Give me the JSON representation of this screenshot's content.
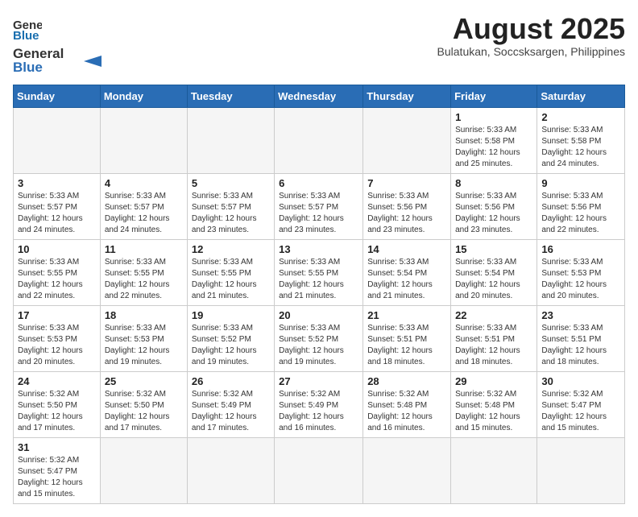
{
  "header": {
    "logo_general": "General",
    "logo_blue": "Blue",
    "month_title": "August 2025",
    "location": "Bulatukan, Soccsksargen, Philippines"
  },
  "weekdays": [
    "Sunday",
    "Monday",
    "Tuesday",
    "Wednesday",
    "Thursday",
    "Friday",
    "Saturday"
  ],
  "weeks": [
    [
      {
        "day": "",
        "info": ""
      },
      {
        "day": "",
        "info": ""
      },
      {
        "day": "",
        "info": ""
      },
      {
        "day": "",
        "info": ""
      },
      {
        "day": "",
        "info": ""
      },
      {
        "day": "1",
        "info": "Sunrise: 5:33 AM\nSunset: 5:58 PM\nDaylight: 12 hours\nand 25 minutes."
      },
      {
        "day": "2",
        "info": "Sunrise: 5:33 AM\nSunset: 5:58 PM\nDaylight: 12 hours\nand 24 minutes."
      }
    ],
    [
      {
        "day": "3",
        "info": "Sunrise: 5:33 AM\nSunset: 5:57 PM\nDaylight: 12 hours\nand 24 minutes."
      },
      {
        "day": "4",
        "info": "Sunrise: 5:33 AM\nSunset: 5:57 PM\nDaylight: 12 hours\nand 24 minutes."
      },
      {
        "day": "5",
        "info": "Sunrise: 5:33 AM\nSunset: 5:57 PM\nDaylight: 12 hours\nand 23 minutes."
      },
      {
        "day": "6",
        "info": "Sunrise: 5:33 AM\nSunset: 5:57 PM\nDaylight: 12 hours\nand 23 minutes."
      },
      {
        "day": "7",
        "info": "Sunrise: 5:33 AM\nSunset: 5:56 PM\nDaylight: 12 hours\nand 23 minutes."
      },
      {
        "day": "8",
        "info": "Sunrise: 5:33 AM\nSunset: 5:56 PM\nDaylight: 12 hours\nand 23 minutes."
      },
      {
        "day": "9",
        "info": "Sunrise: 5:33 AM\nSunset: 5:56 PM\nDaylight: 12 hours\nand 22 minutes."
      }
    ],
    [
      {
        "day": "10",
        "info": "Sunrise: 5:33 AM\nSunset: 5:55 PM\nDaylight: 12 hours\nand 22 minutes."
      },
      {
        "day": "11",
        "info": "Sunrise: 5:33 AM\nSunset: 5:55 PM\nDaylight: 12 hours\nand 22 minutes."
      },
      {
        "day": "12",
        "info": "Sunrise: 5:33 AM\nSunset: 5:55 PM\nDaylight: 12 hours\nand 21 minutes."
      },
      {
        "day": "13",
        "info": "Sunrise: 5:33 AM\nSunset: 5:55 PM\nDaylight: 12 hours\nand 21 minutes."
      },
      {
        "day": "14",
        "info": "Sunrise: 5:33 AM\nSunset: 5:54 PM\nDaylight: 12 hours\nand 21 minutes."
      },
      {
        "day": "15",
        "info": "Sunrise: 5:33 AM\nSunset: 5:54 PM\nDaylight: 12 hours\nand 20 minutes."
      },
      {
        "day": "16",
        "info": "Sunrise: 5:33 AM\nSunset: 5:53 PM\nDaylight: 12 hours\nand 20 minutes."
      }
    ],
    [
      {
        "day": "17",
        "info": "Sunrise: 5:33 AM\nSunset: 5:53 PM\nDaylight: 12 hours\nand 20 minutes."
      },
      {
        "day": "18",
        "info": "Sunrise: 5:33 AM\nSunset: 5:53 PM\nDaylight: 12 hours\nand 19 minutes."
      },
      {
        "day": "19",
        "info": "Sunrise: 5:33 AM\nSunset: 5:52 PM\nDaylight: 12 hours\nand 19 minutes."
      },
      {
        "day": "20",
        "info": "Sunrise: 5:33 AM\nSunset: 5:52 PM\nDaylight: 12 hours\nand 19 minutes."
      },
      {
        "day": "21",
        "info": "Sunrise: 5:33 AM\nSunset: 5:51 PM\nDaylight: 12 hours\nand 18 minutes."
      },
      {
        "day": "22",
        "info": "Sunrise: 5:33 AM\nSunset: 5:51 PM\nDaylight: 12 hours\nand 18 minutes."
      },
      {
        "day": "23",
        "info": "Sunrise: 5:33 AM\nSunset: 5:51 PM\nDaylight: 12 hours\nand 18 minutes."
      }
    ],
    [
      {
        "day": "24",
        "info": "Sunrise: 5:32 AM\nSunset: 5:50 PM\nDaylight: 12 hours\nand 17 minutes."
      },
      {
        "day": "25",
        "info": "Sunrise: 5:32 AM\nSunset: 5:50 PM\nDaylight: 12 hours\nand 17 minutes."
      },
      {
        "day": "26",
        "info": "Sunrise: 5:32 AM\nSunset: 5:49 PM\nDaylight: 12 hours\nand 17 minutes."
      },
      {
        "day": "27",
        "info": "Sunrise: 5:32 AM\nSunset: 5:49 PM\nDaylight: 12 hours\nand 16 minutes."
      },
      {
        "day": "28",
        "info": "Sunrise: 5:32 AM\nSunset: 5:48 PM\nDaylight: 12 hours\nand 16 minutes."
      },
      {
        "day": "29",
        "info": "Sunrise: 5:32 AM\nSunset: 5:48 PM\nDaylight: 12 hours\nand 15 minutes."
      },
      {
        "day": "30",
        "info": "Sunrise: 5:32 AM\nSunset: 5:47 PM\nDaylight: 12 hours\nand 15 minutes."
      }
    ],
    [
      {
        "day": "31",
        "info": "Sunrise: 5:32 AM\nSunset: 5:47 PM\nDaylight: 12 hours\nand 15 minutes."
      },
      {
        "day": "",
        "info": ""
      },
      {
        "day": "",
        "info": ""
      },
      {
        "day": "",
        "info": ""
      },
      {
        "day": "",
        "info": ""
      },
      {
        "day": "",
        "info": ""
      },
      {
        "day": "",
        "info": ""
      }
    ]
  ]
}
